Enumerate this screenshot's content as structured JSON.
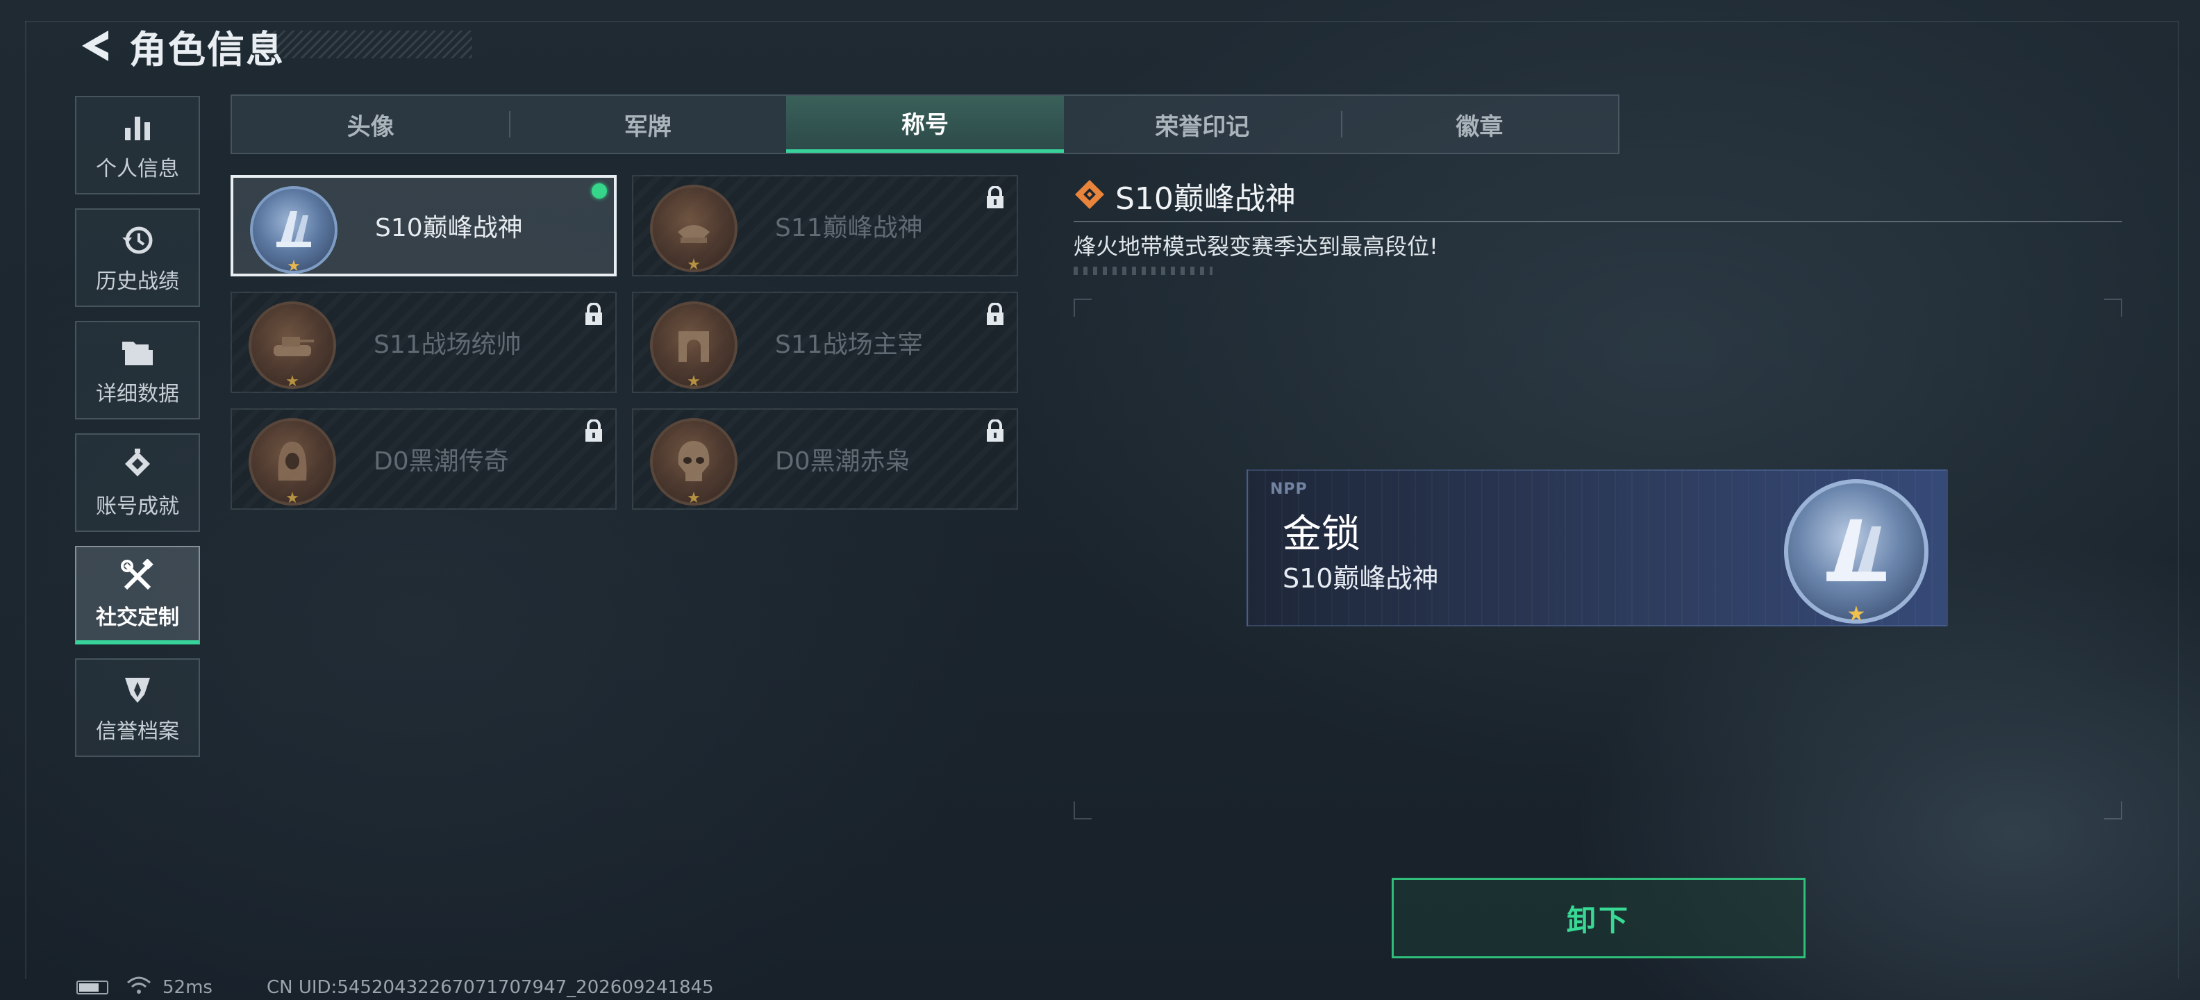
{
  "header": {
    "title": "角色信息"
  },
  "sidebar": {
    "items": [
      {
        "label": "个人信息",
        "icon": "bar-chart-icon",
        "active": false
      },
      {
        "label": "历史战绩",
        "icon": "history-clock-icon",
        "active": false
      },
      {
        "label": "详细数据",
        "icon": "folder-icon",
        "active": false
      },
      {
        "label": "账号成就",
        "icon": "achievement-icon",
        "active": false
      },
      {
        "label": "社交定制",
        "icon": "tools-icon",
        "active": true
      },
      {
        "label": "信誉档案",
        "icon": "reputation-icon",
        "active": false
      }
    ]
  },
  "tabs": [
    {
      "label": "头像",
      "active": false
    },
    {
      "label": "军牌",
      "active": false
    },
    {
      "label": "称号",
      "active": true
    },
    {
      "label": "荣誉印记",
      "active": false
    },
    {
      "label": "徽章",
      "active": false
    }
  ],
  "titles": [
    {
      "name": "S10巅峰战神",
      "locked": false,
      "selected": true,
      "equipped": true,
      "medal": "blue-peak-medal"
    },
    {
      "name": "S11巅峰战神",
      "locked": true,
      "selected": false,
      "equipped": false,
      "medal": "bronze-peak-medal"
    },
    {
      "name": "S11战场统帅",
      "locked": true,
      "selected": false,
      "equipped": false,
      "medal": "bronze-tank-medal"
    },
    {
      "name": "S11战场主宰",
      "locked": true,
      "selected": false,
      "equipped": false,
      "medal": "bronze-arch-medal"
    },
    {
      "name": "D0黑潮传奇",
      "locked": true,
      "selected": false,
      "equipped": false,
      "medal": "bronze-hood-medal"
    },
    {
      "name": "D0黑潮赤枭",
      "locked": true,
      "selected": false,
      "equipped": false,
      "medal": "bronze-skull-medal"
    }
  ],
  "detail": {
    "name": "S10巅峰战神",
    "description": "烽火地带模式裂变赛季达到最高段位!"
  },
  "banner": {
    "logo": "NPP",
    "title": "金锁",
    "subtitle": "S10巅峰战神"
  },
  "action": {
    "label": "卸下"
  },
  "status": {
    "ping": "52ms",
    "uid": "CN UID:545204322670717079​47_202609241845"
  },
  "colors": {
    "accent_green": "#38d39a",
    "lock_locked": "#dfe5ea",
    "medal_star": "#e8b64a"
  }
}
